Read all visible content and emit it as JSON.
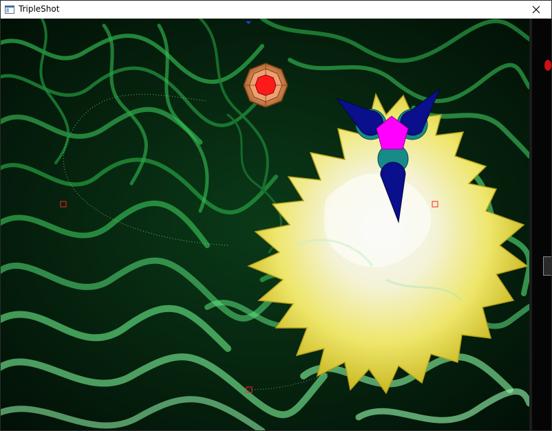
{
  "window": {
    "title": "TripleShot",
    "close_label": "✕"
  },
  "icons": {
    "app": "app-window-icon",
    "close": "close-icon"
  },
  "colors": {
    "background_dark": "#031a08",
    "background_light": "#39c65a",
    "ship_body": "#0a0f8c",
    "ship_ring": "#178a8a",
    "ship_core": "#ff00ff",
    "explosion": "#f0e040",
    "enemy_core": "#ff1a1a",
    "enemy_rim": "#d98a50",
    "marker": "#ff2020"
  },
  "game": {
    "player_ship": "player-ship",
    "enemy": "orange-mine",
    "explosion": "yellow-explosion",
    "markers": [
      "target-marker",
      "target-marker",
      "target-marker"
    ]
  }
}
